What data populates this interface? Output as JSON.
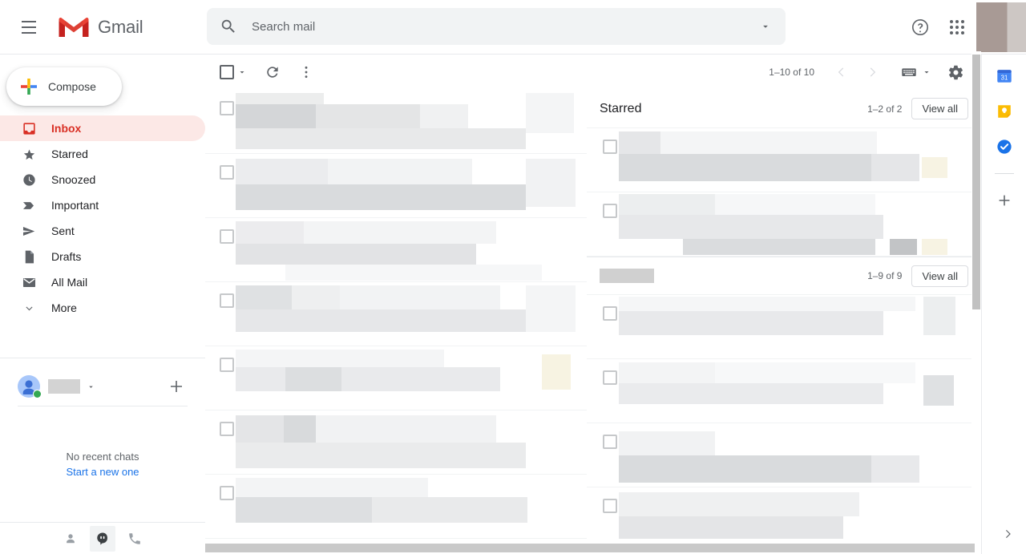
{
  "app": {
    "brand_name": "Gmail",
    "accent_red": "#d93025",
    "active_pill_bg": "#fce8e6",
    "link_blue": "#1a73e8"
  },
  "topbar": {
    "menu_icon": "hamburger-icon",
    "logo_icon": "gmail-logo-icon",
    "help_icon": "help-circle-icon",
    "apps_icon": "apps-grid-icon",
    "avatar": "profile-avatar"
  },
  "search": {
    "placeholder": "Search mail",
    "value": "",
    "search_icon": "search-icon",
    "options_icon": "chevron-down-icon"
  },
  "sidebar": {
    "compose_label": "Compose",
    "items": [
      {
        "label": "Inbox",
        "icon": "inbox-icon",
        "active": true
      },
      {
        "label": "Starred",
        "icon": "star-icon",
        "active": false
      },
      {
        "label": "Snoozed",
        "icon": "clock-icon",
        "active": false
      },
      {
        "label": "Important",
        "icon": "important-chevron-icon",
        "active": false
      },
      {
        "label": "Sent",
        "icon": "send-icon",
        "active": false
      },
      {
        "label": "Drafts",
        "icon": "draft-file-icon",
        "active": false
      },
      {
        "label": "All Mail",
        "icon": "mail-stack-icon",
        "active": false
      },
      {
        "label": "More",
        "icon": "chevron-down-icon",
        "active": false
      }
    ],
    "chat": {
      "status": "online",
      "name_redacted": true,
      "add_icon": "plus-icon",
      "empty_title": "No recent chats",
      "empty_link": "Start a new one",
      "bottom_icons": [
        "contacts-icon",
        "hangouts-chat-icon",
        "phone-icon"
      ],
      "active_bottom_icon": "hangouts-chat-icon"
    }
  },
  "toolbar": {
    "select_all_icon": "checkbox-icon",
    "select_all_caret": "chevron-down-icon",
    "refresh_icon": "refresh-icon",
    "more_icon": "more-vertical-icon",
    "pagination": "1–10 of 10",
    "prev_icon": "chevron-left-icon",
    "next_icon": "chevron-right-icon",
    "input_tools_icon": "keyboard-icon",
    "input_tools_caret": "chevron-down-icon",
    "settings_icon": "gear-icon"
  },
  "email_list": {
    "redacted": true,
    "row_count": 7,
    "rows": [
      {
        "checkbox": "unchecked"
      },
      {
        "checkbox": "unchecked"
      },
      {
        "checkbox": "unchecked"
      },
      {
        "checkbox": "unchecked"
      },
      {
        "checkbox": "unchecked"
      },
      {
        "checkbox": "unchecked"
      },
      {
        "checkbox": "unchecked"
      }
    ]
  },
  "panels": [
    {
      "title": "Starred",
      "title_redacted": false,
      "count": "1–2 of 2",
      "view_all_label": "View all",
      "rows": 2
    },
    {
      "title": "",
      "title_redacted": true,
      "count": "1–9 of 9",
      "view_all_label": "View all",
      "rows": 4
    }
  ],
  "rail": {
    "items": [
      {
        "icon": "google-calendar-icon",
        "color": "#4285f4"
      },
      {
        "icon": "google-keep-icon",
        "color": "#fbbc04"
      },
      {
        "icon": "google-tasks-icon",
        "color": "#1a73e8"
      }
    ],
    "add_icon": "plus-icon",
    "expand_icon": "chevron-right-icon"
  },
  "scrollbars": {
    "vertical_icon": "vertical-scrollbar",
    "horizontal_icon": "horizontal-scrollbar"
  }
}
